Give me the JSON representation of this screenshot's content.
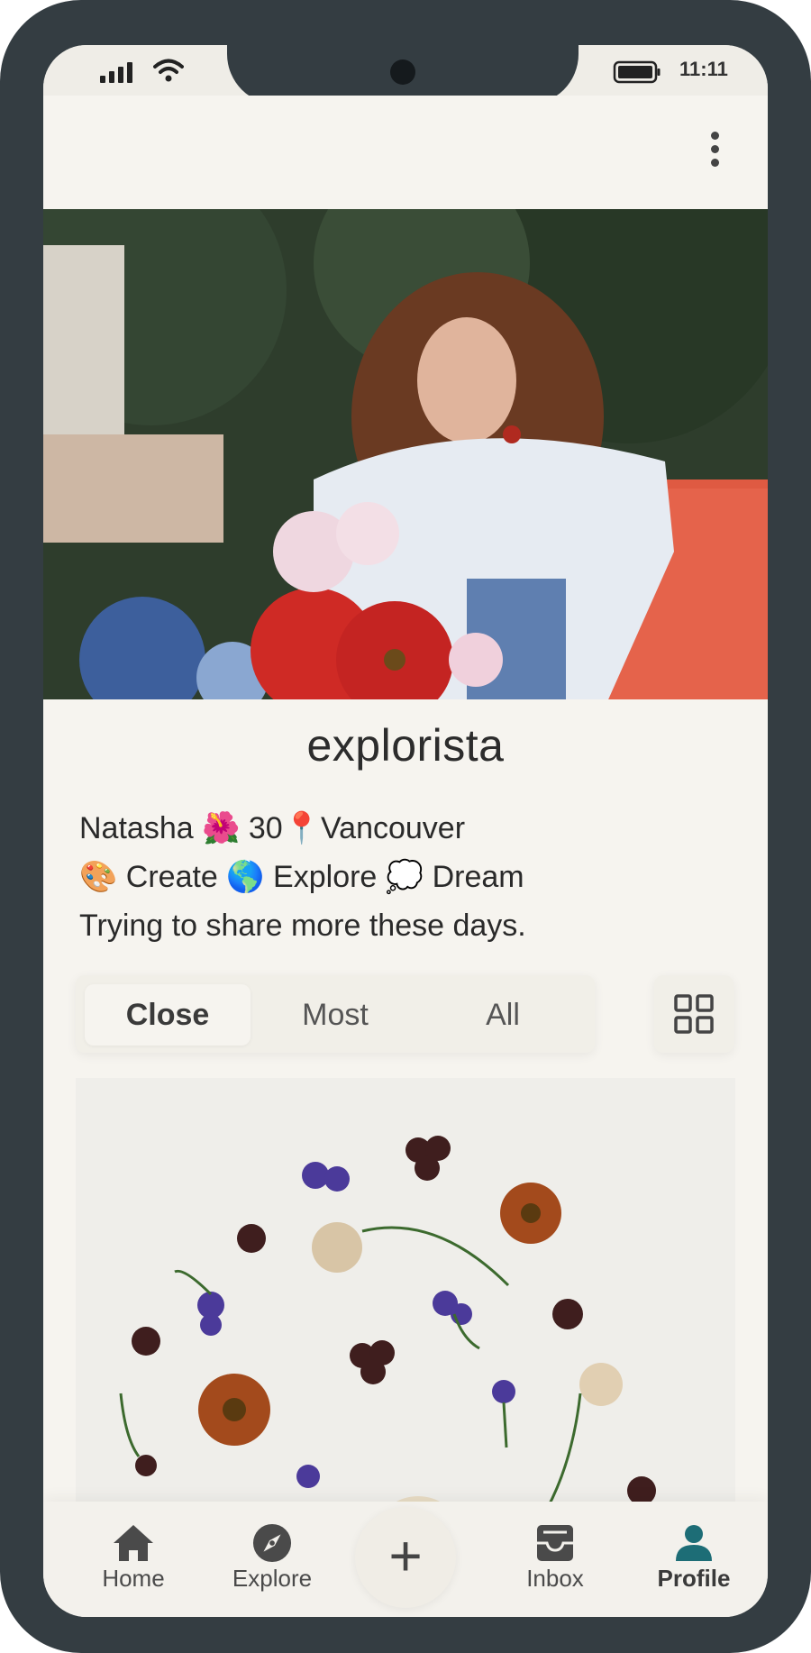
{
  "status_bar": {
    "time": "11:11",
    "icons": [
      "signal-icon",
      "wifi-icon",
      "battery-icon"
    ]
  },
  "header": {
    "menu_icon": "more-vertical-icon"
  },
  "profile": {
    "cover_photo": "portrait of a curly-haired woman on a bicycle with flowers",
    "username": "explorista",
    "bio_lines": [
      "Natasha 🌺 30📍Vancouver",
      "🎨 Create 🌎 Explore 💭 Dream",
      "Trying to share more these days."
    ]
  },
  "filters": {
    "tabs": [
      {
        "label": "Close",
        "active": true
      },
      {
        "label": "Most",
        "active": false
      },
      {
        "label": "All",
        "active": false
      }
    ],
    "view_toggle_icon": "grid-icon"
  },
  "post": {
    "image": "pressed flowers arranged on white canvas"
  },
  "bottom_nav": {
    "items": [
      {
        "label": "Home",
        "icon": "home-icon",
        "active": false
      },
      {
        "label": "Explore",
        "icon": "compass-icon",
        "active": false
      },
      {
        "label": "Inbox",
        "icon": "inbox-icon",
        "active": false
      },
      {
        "label": "Profile",
        "icon": "person-icon",
        "active": true
      }
    ],
    "add_symbol": "+",
    "accent": "#1d6d76"
  }
}
